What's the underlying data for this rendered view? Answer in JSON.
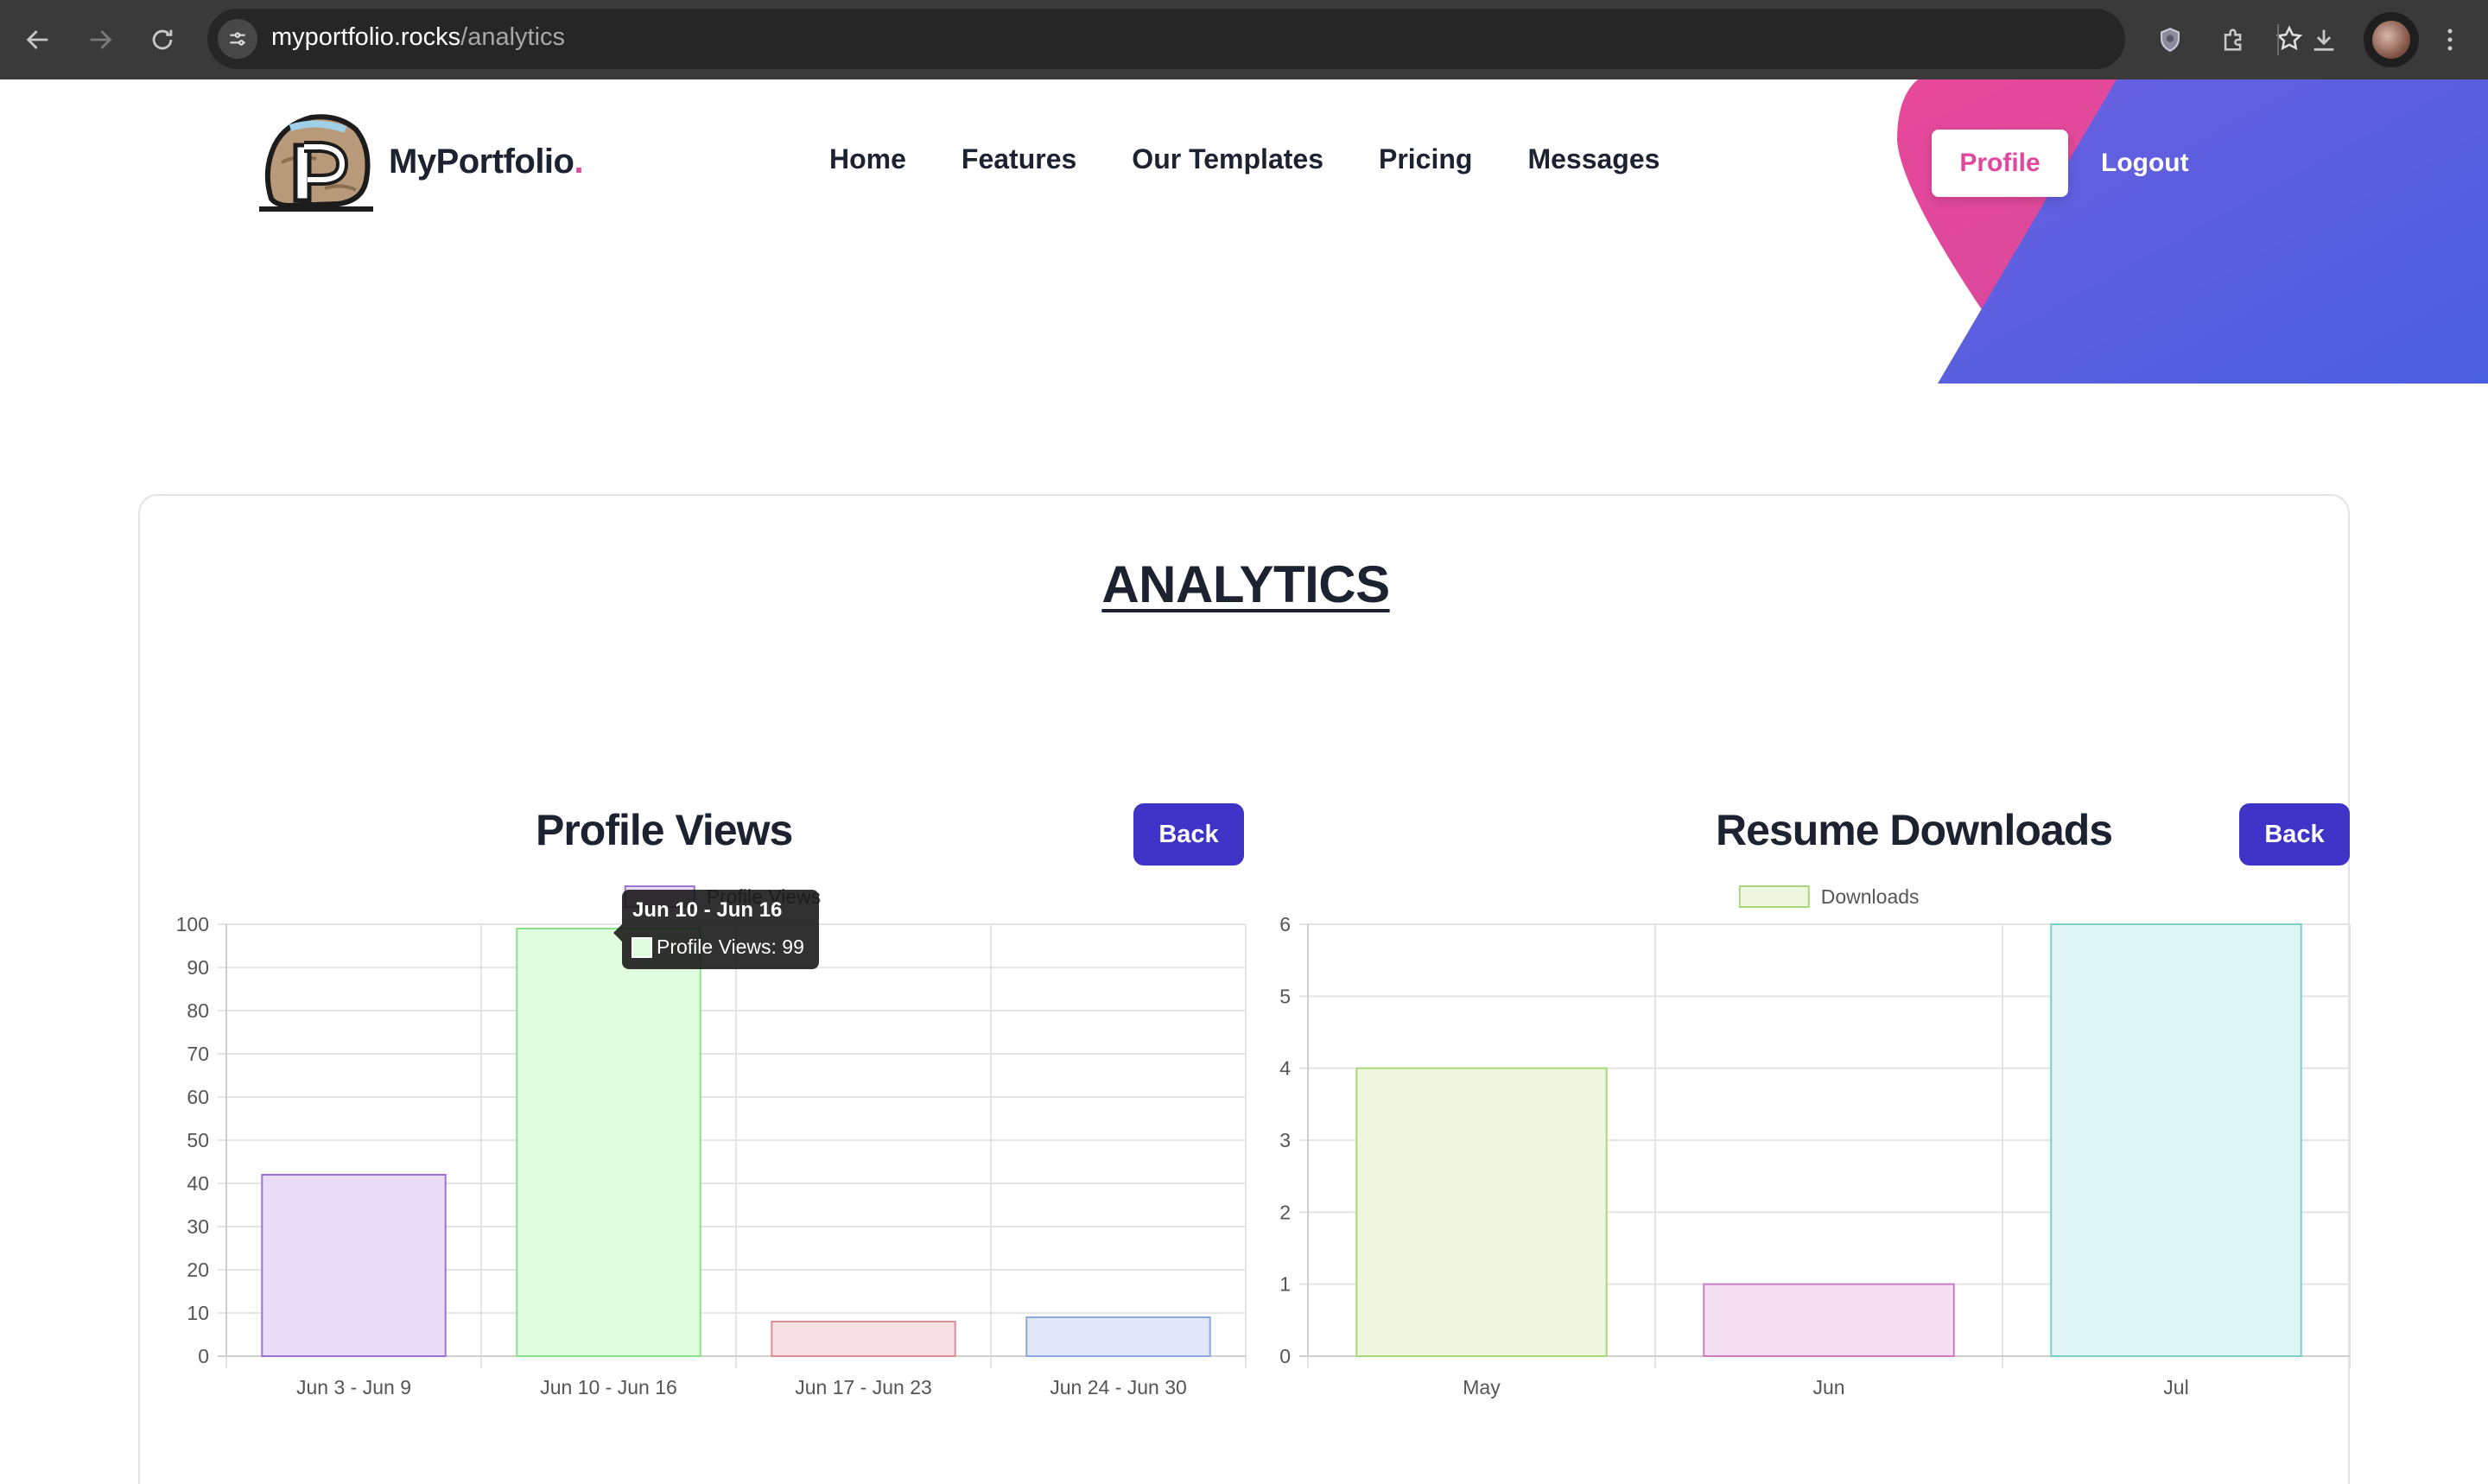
{
  "browser": {
    "url_host": "myportfolio.rocks",
    "url_path": "/analytics"
  },
  "site": {
    "brand": "MyPortfolio",
    "brand_dot": ".",
    "nav": [
      "Home",
      "Features",
      "Our Templates",
      "Pricing",
      "Messages"
    ],
    "profile_label": "Profile",
    "logout_label": "Logout",
    "colors": {
      "accent_pink": "#e0479d",
      "accent_blue": "#5a5ae0",
      "button": "#3f33c7"
    }
  },
  "page": {
    "title": "ANALYTICS"
  },
  "panels": {
    "views": {
      "title": "Profile Views",
      "back_label": "Back"
    },
    "downloads": {
      "title": "Resume Downloads",
      "back_label": "Back"
    }
  },
  "tooltip": {
    "title": "Jun 10 - Jun 16",
    "label": "Profile Views: 99"
  },
  "chart_data": [
    {
      "type": "bar",
      "title": "Profile Views",
      "categories": [
        "Jun 3 - Jun 9",
        "Jun 10 - Jun 16",
        "Jun 17 - Jun 23",
        "Jun 24 - Jun 30"
      ],
      "series": [
        {
          "name": "Profile Views",
          "values": [
            42,
            99,
            8,
            9
          ]
        }
      ],
      "bar_colors": [
        {
          "fill": "#e8dcf6",
          "stroke": "#a070d8"
        },
        {
          "fill": "#e0fde0",
          "stroke": "#88e288"
        },
        {
          "fill": "#f6e0e4",
          "stroke": "#de8c98"
        },
        {
          "fill": "#e2e8f8",
          "stroke": "#8ca6e0"
        }
      ],
      "legend_color": {
        "fill": "#e8dcf6",
        "stroke": "#a070d8"
      },
      "ylim": [
        0,
        100
      ],
      "yticks": [
        0,
        10,
        20,
        30,
        40,
        50,
        60,
        70,
        80,
        90,
        100
      ],
      "grid": true,
      "legend": "top-center"
    },
    {
      "type": "bar",
      "title": "Resume Downloads",
      "categories": [
        "May",
        "Jun",
        "Jul"
      ],
      "series": [
        {
          "name": "Downloads",
          "values": [
            4,
            1,
            6
          ]
        }
      ],
      "bar_colors": [
        {
          "fill": "#eef6e0",
          "stroke": "#a8d878"
        },
        {
          "fill": "#f4e0f2",
          "stroke": "#cc7ac4"
        },
        {
          "fill": "#e0f6f4",
          "stroke": "#7ad0c8"
        }
      ],
      "legend_color": {
        "fill": "#eef6e0",
        "stroke": "#a8d878"
      },
      "ylim": [
        0,
        6
      ],
      "yticks": [
        0,
        1,
        2,
        3,
        4,
        5,
        6
      ],
      "grid": true,
      "legend": "top-center"
    }
  ]
}
